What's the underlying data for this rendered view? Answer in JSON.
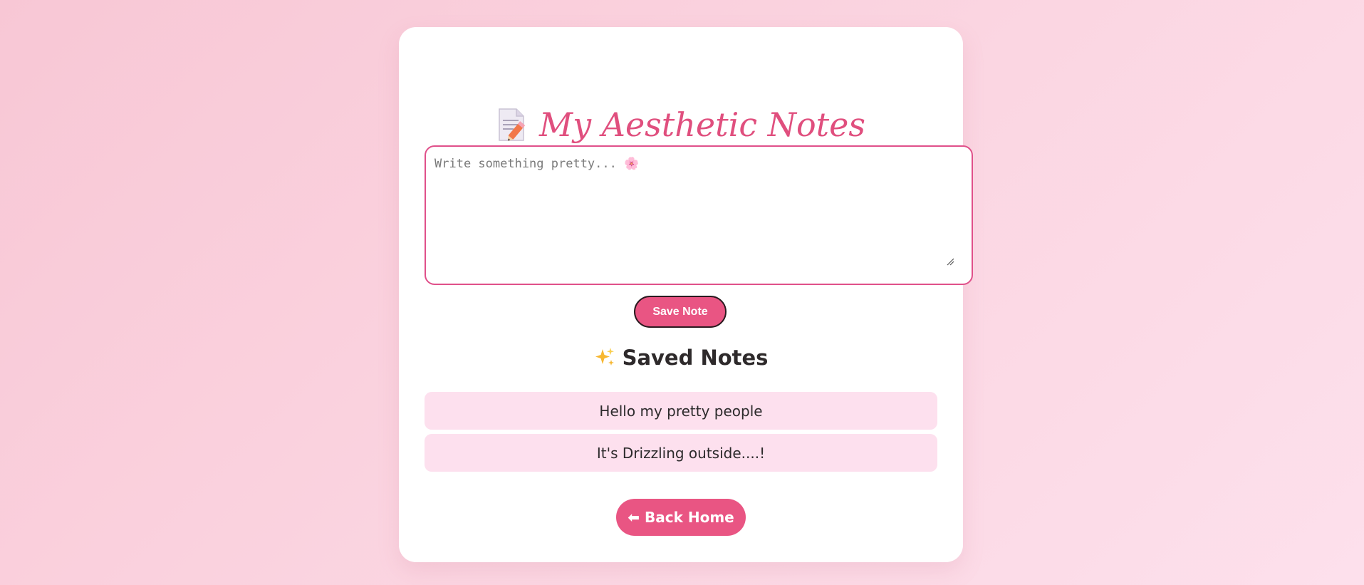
{
  "header": {
    "title": "My Aesthetic Notes",
    "icon": "memo-icon"
  },
  "editor": {
    "placeholder": "Write something pretty... 🌸",
    "value": ""
  },
  "actions": {
    "save_label": "Save Note",
    "back_label": "⬅ Back Home"
  },
  "saved": {
    "title": "Saved Notes",
    "icon": "sparkles-icon",
    "notes": [
      {
        "text": "Hello my pretty people"
      },
      {
        "text": "It's Drizzling outside....!"
      }
    ]
  },
  "colors": {
    "accent": "#e95583",
    "title": "#e04f7e",
    "note_bg": "#fde0ee",
    "card_bg": "#ffffff"
  }
}
